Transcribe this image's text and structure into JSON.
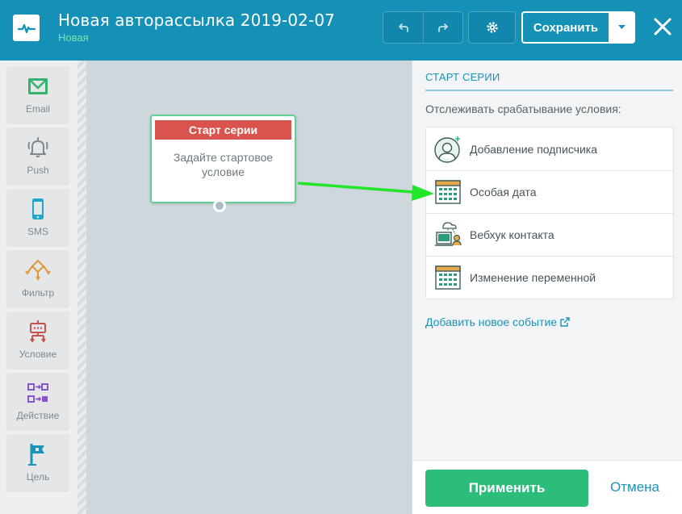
{
  "header": {
    "title": "Новая авторассылка 2019-02-07",
    "status": "Новая",
    "save_label": "Сохранить"
  },
  "toolbar": {
    "items": [
      {
        "label": "Email",
        "icon": "envelope-icon"
      },
      {
        "label": "Push",
        "icon": "bell-icon"
      },
      {
        "label": "SMS",
        "icon": "phone-icon"
      },
      {
        "label": "Фильтр",
        "icon": "filter-icon"
      },
      {
        "label": "Условие",
        "icon": "condition-icon"
      },
      {
        "label": "Действие",
        "icon": "action-icon"
      },
      {
        "label": "Цель",
        "icon": "flag-icon"
      }
    ]
  },
  "canvas": {
    "start_card": {
      "header": "Старт серии",
      "body": "Задайте стартовое условие"
    }
  },
  "panel": {
    "title": "СТАРТ СЕРИИ",
    "subtitle": "Отслеживать срабатывание условия:",
    "events": [
      {
        "label": "Добавление подписчика",
        "icon": "add-subscriber-icon"
      },
      {
        "label": "Особая дата",
        "icon": "calendar-icon"
      },
      {
        "label": "Вебхук контакта",
        "icon": "webhook-icon"
      },
      {
        "label": "Изменение переменной",
        "icon": "calendar-icon"
      }
    ],
    "add_link": "Добавить новое событие",
    "apply": "Применить",
    "cancel": "Отмена"
  },
  "colors": {
    "header": "#1590b7",
    "accent": "#1a93b9",
    "start_header": "#d9534f",
    "apply": "#2dbd7a",
    "arrow": "#22e62a"
  }
}
